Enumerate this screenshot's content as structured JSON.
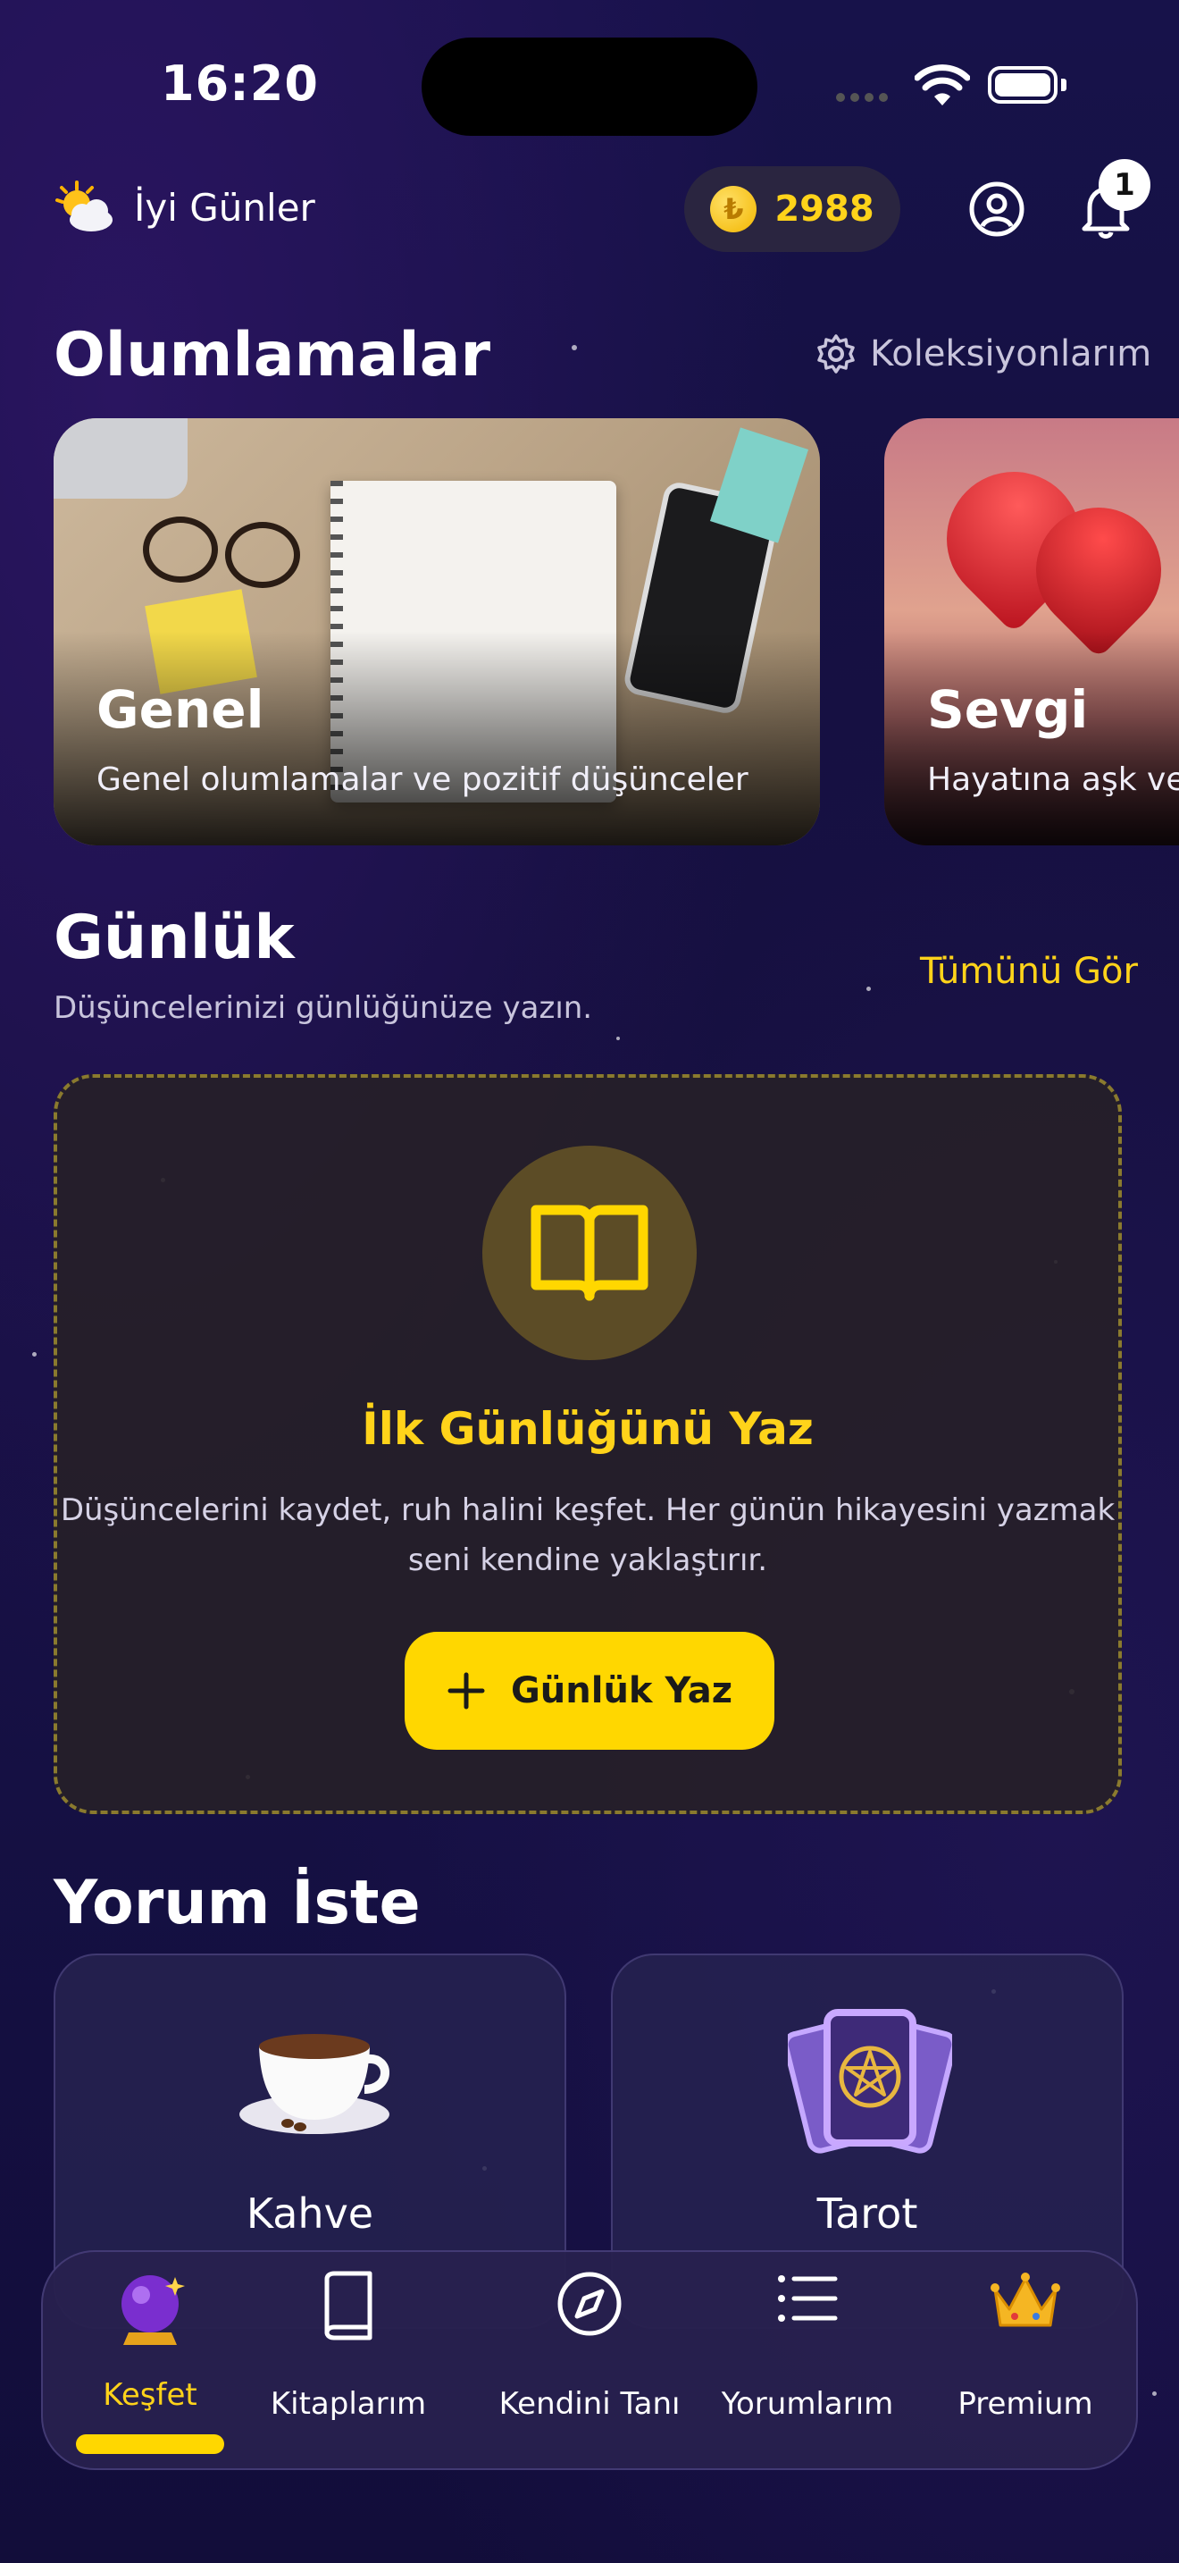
{
  "status_bar": {
    "time": "16:20"
  },
  "header": {
    "greeting": "İyi Günler",
    "coins": "2988",
    "notification_count": "1"
  },
  "affirmations": {
    "title": "Olumlamalar",
    "collections_label": "Koleksiyonlarım",
    "cards": [
      {
        "title": "Genel",
        "desc": "Genel olumlamalar ve pozitif düşünceler"
      },
      {
        "title": "Sevgi",
        "desc": "Hayatına aşk ve s"
      }
    ]
  },
  "journal": {
    "title": "Günlük",
    "subtitle": "Düşüncelerinizi günlüğünüze yazın.",
    "see_all": "Tümünü Gör",
    "empty_title": "İlk Günlüğünü Yaz",
    "empty_desc_line1": "Düşüncelerini kaydet, ruh halini keşfet. Her günün hikayesini yazmak",
    "empty_desc_line2": "seni kendine yaklaştırır.",
    "button": "Günlük Yaz"
  },
  "ask_comment": {
    "title": "Yorum İste",
    "cards": [
      {
        "label": "Kahve",
        "icon": "coffee-cup-icon"
      },
      {
        "label": "Tarot",
        "icon": "tarot-cards-icon"
      }
    ]
  },
  "nav": {
    "items": [
      {
        "label": "Keşfet",
        "icon": "crystal-ball-icon",
        "active": true
      },
      {
        "label": "Kitaplarım",
        "icon": "book-icon"
      },
      {
        "label": "Kendini Tanı",
        "icon": "compass-icon"
      },
      {
        "label": "Yorumlarım",
        "icon": "list-icon"
      },
      {
        "label": "Premium",
        "icon": "crown-icon"
      }
    ]
  },
  "colors": {
    "accent": "#ffd700",
    "background": "#151043"
  }
}
